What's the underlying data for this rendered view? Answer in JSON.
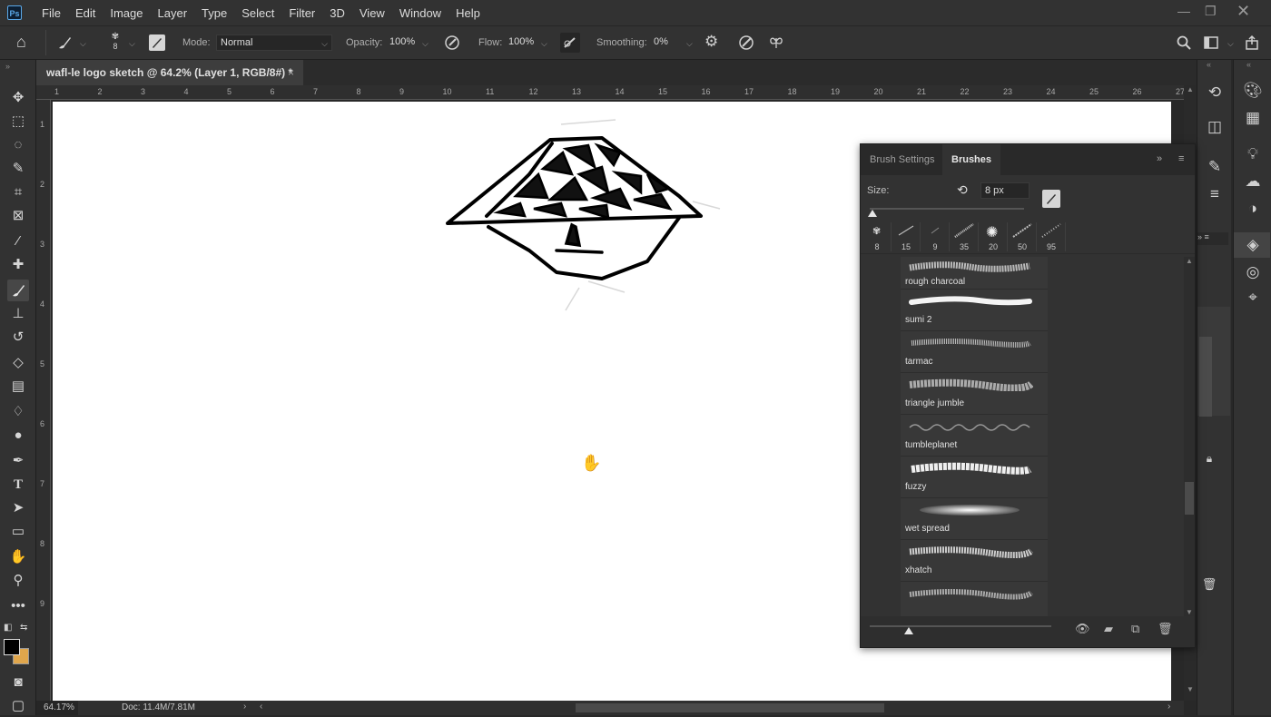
{
  "app": {
    "logo": "Ps"
  },
  "menu": [
    "File",
    "Edit",
    "Image",
    "Layer",
    "Type",
    "Select",
    "Filter",
    "3D",
    "View",
    "Window",
    "Help"
  ],
  "options": {
    "mode_label": "Mode:",
    "mode_value": "Normal",
    "opacity_label": "Opacity:",
    "opacity_value": "100%",
    "flow_label": "Flow:",
    "flow_value": "100%",
    "smoothing_label": "Smoothing:",
    "smoothing_value": "0%",
    "brush_size_indicator": "8"
  },
  "document": {
    "tab_title": "wafl-le logo sketch @ 64.2% (Layer 1, RGB/8#) *",
    "close_glyph": "×"
  },
  "ruler": {
    "h_ticks": [
      "1",
      "2",
      "3",
      "4",
      "5",
      "6",
      "7",
      "8",
      "9",
      "10",
      "11",
      "12",
      "13",
      "14",
      "15",
      "16",
      "17",
      "18",
      "19",
      "20",
      "21",
      "22",
      "23",
      "24",
      "25",
      "26",
      "27"
    ],
    "v_ticks": [
      "1",
      "2",
      "3",
      "4",
      "5",
      "6",
      "7",
      "8",
      "9"
    ]
  },
  "status": {
    "zoom": "64.17%",
    "doc": "Doc: 11.4M/7.81M"
  },
  "brush_panel": {
    "tab_settings": "Brush Settings",
    "tab_brushes": "Brushes",
    "size_label": "Size:",
    "size_value": "8 px",
    "presets": [
      "8",
      "15",
      "9",
      "35",
      "20",
      "50",
      "95"
    ],
    "brushes": [
      "rough charcoal",
      "sumi 2",
      "tarmac",
      "triangle jumble",
      "tumbleplanet",
      "fuzzy",
      "wet spread",
      "xhatch"
    ]
  },
  "colors": {
    "foreground": "#000000",
    "background": "#e0a64c",
    "accent": "#5aa8e8"
  }
}
